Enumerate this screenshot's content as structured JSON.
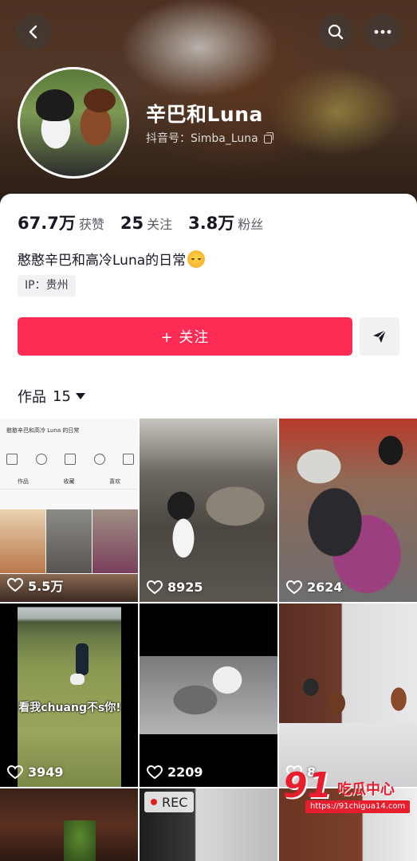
{
  "header": {
    "back_icon": "chevron-left-icon",
    "search_icon": "search-icon",
    "more_icon": "more-horizontal-icon"
  },
  "profile": {
    "name": "辛巴和Luna",
    "douyin_id": "抖音号：Simba_Luna",
    "stats": [
      {
        "value": "67.7万",
        "label": "获赞"
      },
      {
        "value": "25",
        "label": "关注"
      },
      {
        "value": "3.8万",
        "label": "粉丝"
      }
    ],
    "bio": "憨憨辛巴和高冷Luna的日常",
    "ip": "IP：贵州"
  },
  "actions": {
    "follow_label": "+ 关注",
    "share_icon": "send-icon"
  },
  "tabs": {
    "works_label": "作品",
    "works_count": "15"
  },
  "videos": [
    {
      "likes": "5.5万"
    },
    {
      "likes": "8925"
    },
    {
      "likes": "2624"
    },
    {
      "likes": "3949",
      "caption": "看我chuang不s你!"
    },
    {
      "likes": "2209"
    },
    {
      "likes": "8"
    },
    {
      "likes": ""
    },
    {
      "likes": "",
      "badge": "REC"
    },
    {
      "likes": ""
    }
  ],
  "screenshot_thumb": {
    "bio": "憨憨辛巴和高冷 Luna 的日常",
    "tab1": "作品",
    "tab2": "收藏",
    "tab3": "喜欢"
  },
  "watermark": {
    "logo": "91",
    "name": "吃瓜中心",
    "url": "https://91chigua14.com"
  },
  "colors": {
    "accent": "#fe2c55",
    "watermark": "#e81d2d"
  }
}
